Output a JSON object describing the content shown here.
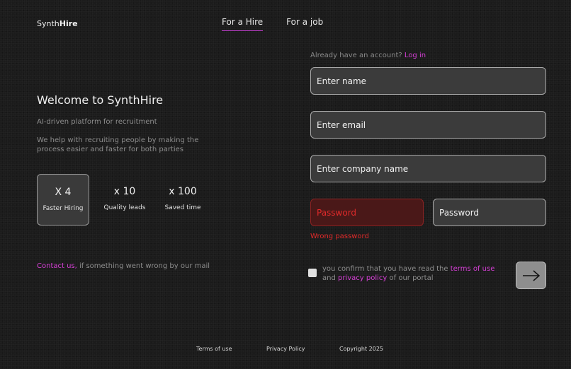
{
  "brand": {
    "prefix": "Synth",
    "bold": "Hire"
  },
  "nav": {
    "tabs": [
      {
        "label": "For a Hire",
        "active": true
      },
      {
        "label": "For a job",
        "active": false
      }
    ]
  },
  "welcome": {
    "title": "Welcome to SynthHire",
    "subtitle": "AI-driven platform for recruitment",
    "description": "We help with recruiting people by making the process easier and faster for both parties"
  },
  "stats": [
    {
      "value": "X 4",
      "label": "Faster Hiring"
    },
    {
      "value": "x 10",
      "label": "Quality leads"
    },
    {
      "value": "x 100",
      "label": "Saved time"
    }
  ],
  "contact": {
    "link": "Contact us,",
    "text": " if something went wrong by our mail"
  },
  "form": {
    "already_text": "Already have an account? ",
    "login_link": "Log in",
    "name_placeholder": "Enter name",
    "email_placeholder": "Enter email",
    "company_placeholder": "Enter company name",
    "password_placeholder": "Password",
    "confirm_password_placeholder": "Password",
    "error_message": "Wrong password",
    "consent": {
      "part1": "you confirm that you have read the ",
      "terms_link": "terms of use",
      "part2": "and ",
      "privacy_link": "privacy policy",
      "part3": " of our portal"
    },
    "submit_icon": "arrow-right-icon"
  },
  "footer": {
    "terms": "Terms of use",
    "privacy": "Privacy Policy",
    "copyright": "Copyright 2025"
  },
  "colors": {
    "accent": "#d63fd6",
    "error": "#e02a2a",
    "background": "#1b1b1b"
  }
}
